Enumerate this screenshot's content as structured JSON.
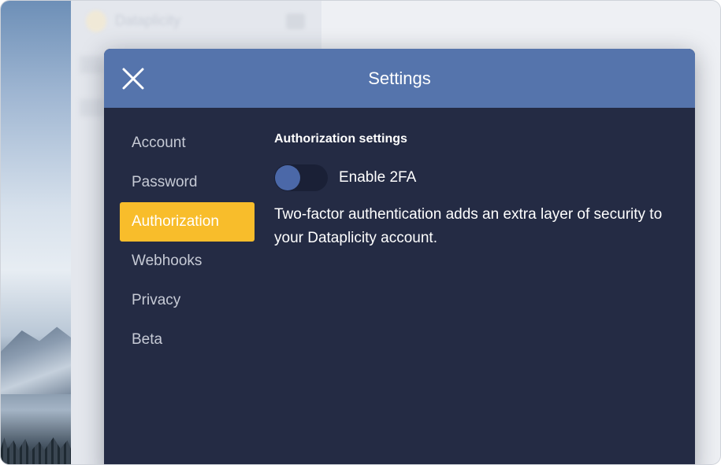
{
  "background_app": {
    "title": "Dataplicity"
  },
  "modal": {
    "title": "Settings",
    "close_icon": "close-icon",
    "nav": [
      {
        "label": "Account",
        "active": false
      },
      {
        "label": "Password",
        "active": false
      },
      {
        "label": "Authorization",
        "active": true
      },
      {
        "label": "Webhooks",
        "active": false
      },
      {
        "label": "Privacy",
        "active": false
      },
      {
        "label": "Beta",
        "active": false
      }
    ],
    "content": {
      "section_title": "Authorization settings",
      "toggle_label": "Enable 2FA",
      "toggle_on": false,
      "description": "Two-factor authentication adds an extra layer of security to your Dataplicity account."
    }
  },
  "colors": {
    "header": "#5574ac",
    "panel": "#242b44",
    "active_nav": "#f8bd2b",
    "toggle_knob": "#4b68a8"
  }
}
